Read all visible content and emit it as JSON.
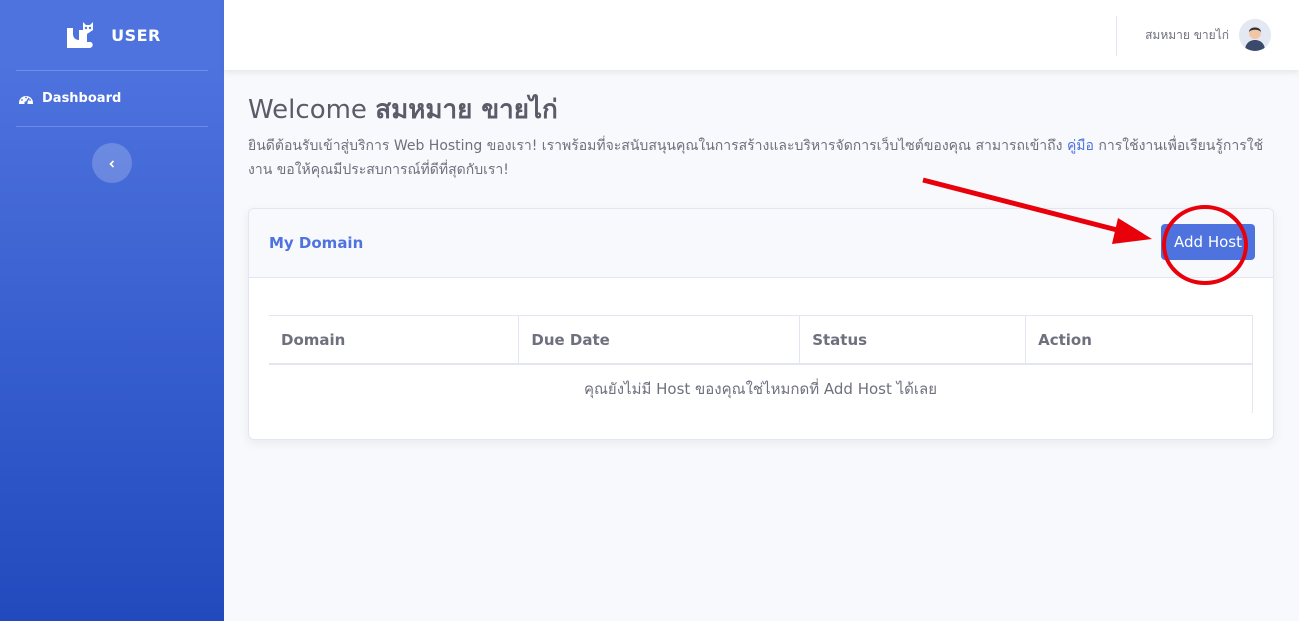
{
  "brand": {
    "title": "USER"
  },
  "sidebar": {
    "items": [
      {
        "label": "Dashboard",
        "icon": "tachometer-icon"
      }
    ],
    "toggle_icon": "chevron-left-icon"
  },
  "topbar": {
    "user_name": "สมหมาย ขายไก่"
  },
  "welcome": {
    "prefix": "Welcome ",
    "name": "สมหมาย ขายไก่",
    "intro_before": "ยินดีต้อนรับเข้าสู่บริการ Web Hosting ของเรา! เราพร้อมที่จะสนับสนุนคุณในการสร้างและบริหารจัดการเว็บไซต์ของคุณ สามารถเข้าถึง ",
    "intro_link": "คู่มือ",
    "intro_after": " การใช้งานเพื่อเรียนรู้การใช้งาน ขอให้คุณมีประสบการณ์ที่ดีที่สุดกับเรา!"
  },
  "card": {
    "title": "My Domain",
    "add_button": "Add Host",
    "columns": [
      "Domain",
      "Due Date",
      "Status",
      "Action"
    ],
    "empty_message": "คุณยังไม่มี Host ของคุณใช่ไหมกดที่ Add Host ได้เลย"
  },
  "colors": {
    "primary": "#4e73df",
    "sidebar_dark": "#224abe",
    "annotation": "#e8000b"
  }
}
